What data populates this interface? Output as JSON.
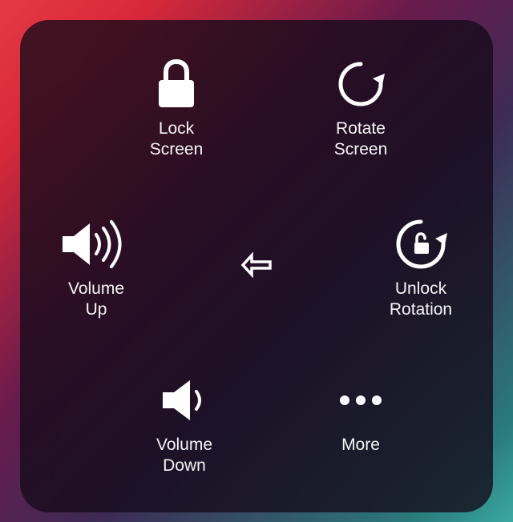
{
  "menu": {
    "lockScreen": {
      "label": "Lock\nScreen"
    },
    "rotateScreen": {
      "label": "Rotate\nScreen"
    },
    "volumeUp": {
      "label": "Volume\nUp"
    },
    "unlockRotation": {
      "label": "Unlock\nRotation"
    },
    "volumeDown": {
      "label": "Volume\nDown"
    },
    "more": {
      "label": "More"
    }
  }
}
